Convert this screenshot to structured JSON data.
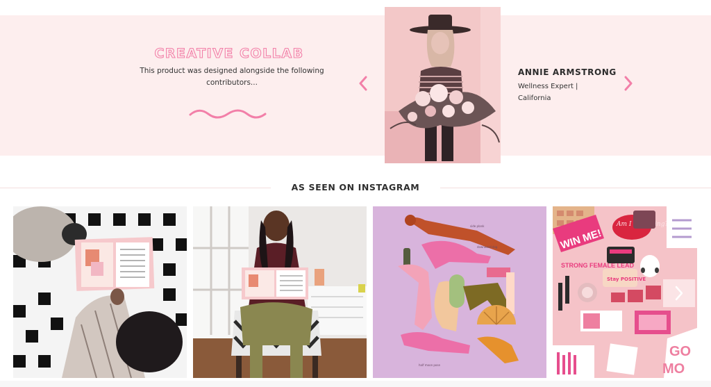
{
  "collab": {
    "title": "CREATIVE COLLAB",
    "description": "This product was designed alongside the following contributors..."
  },
  "contributor": {
    "name": "ANNIE ARMSTRONG",
    "role": "Wellness Expert | California",
    "photo_icon": "contributor-portrait"
  },
  "instagram": {
    "heading": "AS SEEN ON INSTAGRAM",
    "posts": [
      {
        "name": "planner-on-checkered-blanket",
        "alt_icon": "photo"
      },
      {
        "name": "woman-holding-planner",
        "alt_icon": "photo"
      },
      {
        "name": "yoga-poses-illustration",
        "alt_icon": "illustration"
      },
      {
        "name": "pink-products-flatlay",
        "alt_icon": "photo",
        "texts": [
          "WIN ME!",
          "STRONG FEMALE LEAD",
          "Stay POSITIVE",
          "Am I Dreaming?"
        ]
      }
    ]
  },
  "icons": {
    "prev": "chevron-left-icon",
    "next": "chevron-right-icon",
    "wave": "wave-divider-icon"
  },
  "colors": {
    "accent_pink": "#f27fa8",
    "band_bg": "#fdeeee",
    "text_dark": "#2c2c2c"
  }
}
